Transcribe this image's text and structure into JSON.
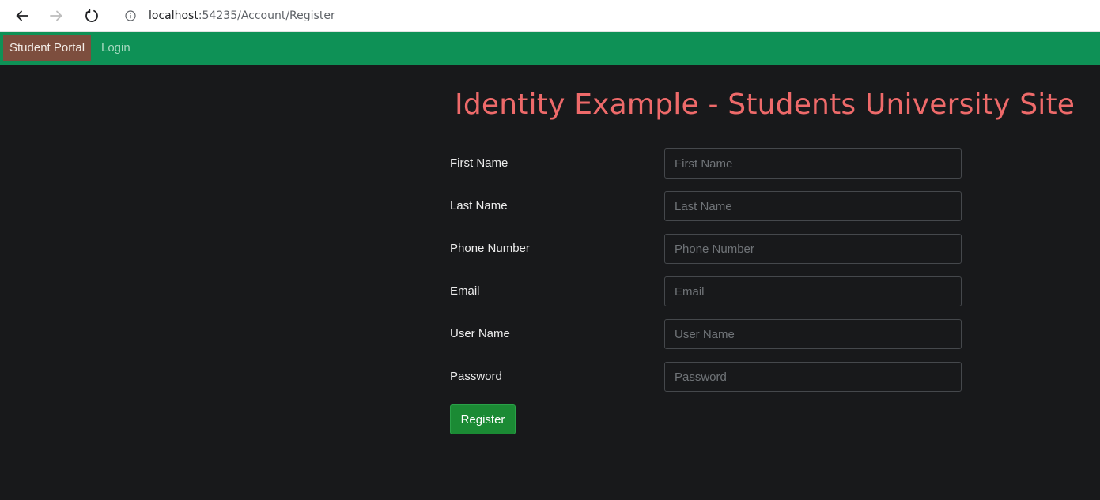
{
  "browser": {
    "url_host": "localhost",
    "url_path": ":54235/Account/Register"
  },
  "navbar": {
    "brand": "Student Portal",
    "login_label": "Login"
  },
  "page": {
    "title": "Identity Example - Students University Site"
  },
  "form": {
    "fields": [
      {
        "label": "First Name",
        "placeholder": "First Name",
        "value": ""
      },
      {
        "label": "Last Name",
        "placeholder": "Last Name",
        "value": ""
      },
      {
        "label": "Phone Number",
        "placeholder": "Phone Number",
        "value": ""
      },
      {
        "label": "Email",
        "placeholder": "Email",
        "value": ""
      },
      {
        "label": "User Name",
        "placeholder": "User Name",
        "value": ""
      },
      {
        "label": "Password",
        "placeholder": "Password",
        "value": ""
      }
    ],
    "submit_label": "Register"
  },
  "colors": {
    "navbar": "#0e9156",
    "brand_bg": "#7d4e3e",
    "title": "#ee6a6a",
    "page_bg": "#18191b",
    "register_button": "#1b8a34"
  },
  "icons": [
    "back-arrow-icon",
    "forward-arrow-icon",
    "reload-icon",
    "info-icon"
  ]
}
